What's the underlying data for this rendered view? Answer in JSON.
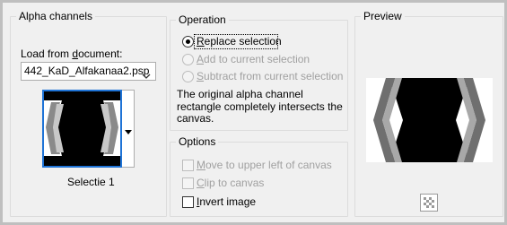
{
  "alpha": {
    "group_title": "Alpha channels",
    "load_label_pre": "Load from ",
    "load_label_accel": "d",
    "load_label_post": "ocument:",
    "document_value": "442_KaD_Alfakanaa2.psp",
    "selection_name": "Selectie 1"
  },
  "operation": {
    "group_title": "Operation",
    "options": [
      {
        "accel": "R",
        "rest": "eplace selection",
        "selected": true,
        "enabled": true
      },
      {
        "accel": "A",
        "rest": "dd to current selection",
        "selected": false,
        "enabled": false
      },
      {
        "accel": "S",
        "rest": "ubtract from current selection",
        "selected": false,
        "enabled": false
      }
    ],
    "info_line1": "The original alpha channel",
    "info_line2": "rectangle completely intersects the",
    "info_line3": "canvas."
  },
  "options": {
    "group_title": "Options",
    "move": {
      "accel": "M",
      "rest": "ove to upper left of canvas",
      "checked": false,
      "enabled": false
    },
    "clip": {
      "accel": "C",
      "rest": "lip to canvas",
      "checked": false,
      "enabled": false
    },
    "invert": {
      "accel": "I",
      "rest": "nvert image",
      "checked": false,
      "enabled": true
    }
  },
  "preview": {
    "group_title": "Preview",
    "zoom_icon": "checkerboard-icon"
  },
  "colors": {
    "dialog_bg": "#f0f0f0",
    "focus_blue": "#1e73d6",
    "disabled_text": "#a0a0a0"
  }
}
